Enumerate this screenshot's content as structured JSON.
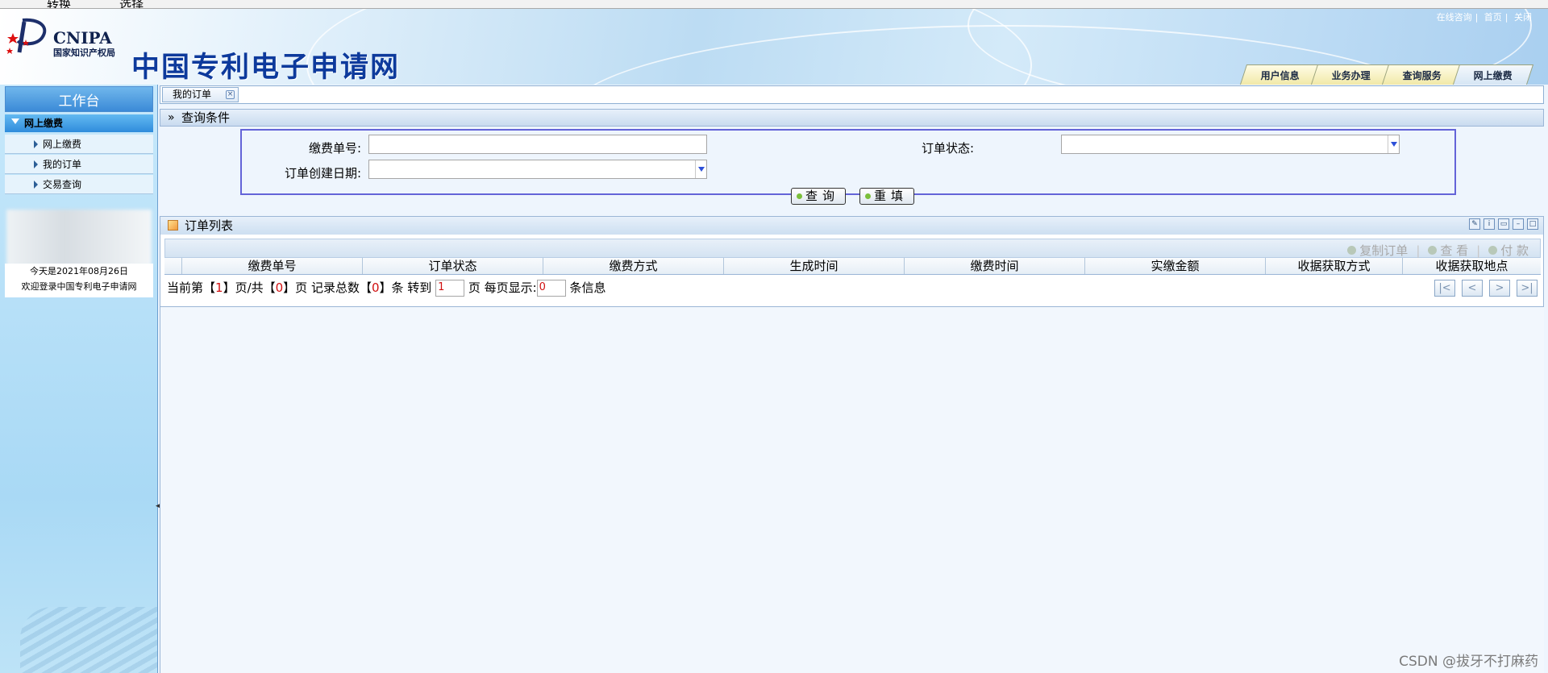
{
  "browser_toolbar": {
    "item1": "转换",
    "item2": "选择"
  },
  "header": {
    "logo_text": "CNIPA",
    "logo_subtitle": "国家知识产权局",
    "site_title": "中国专利电子申请网",
    "top_links": [
      "在线咨询",
      "首页",
      "关闭"
    ],
    "tabs": [
      "用户信息",
      "业务办理",
      "查询服务",
      "网上缴费"
    ],
    "active_tab": "网上缴费"
  },
  "sidebar": {
    "header": "工作台",
    "section": "网上缴费",
    "items": [
      "网上缴费",
      "我的订单",
      "交易查询"
    ],
    "date_text": "今天是2021年08月26日",
    "welcome_text": "欢迎登录中国专利电子申请网"
  },
  "doc_tab": {
    "label": "我的订单",
    "close_icon": "×"
  },
  "query": {
    "title": "查询条件",
    "fee_no_label": "缴费单号:",
    "order_status_label": "订单状态:",
    "create_date_label": "订单创建日期:",
    "search_button": "查询",
    "reset_button": "重填"
  },
  "order_list": {
    "title": "订单列表",
    "toolbar": [
      "复制订单",
      "查 看",
      "付 款"
    ],
    "columns": [
      "缴费单号",
      "订单状态",
      "缴费方式",
      "生成时间",
      "缴费时间",
      "实缴金额",
      "收据获取方式",
      "收据获取地点"
    ],
    "pager": {
      "p1": "当前第【",
      "current_page": "1",
      "p2": "】页/共【",
      "total_pages": "0",
      "p3": "】页 记录总数【",
      "total_records": "0",
      "p4": "】条 转到",
      "goto_value": "1",
      "p5": "页 每页显示:",
      "per_page_value": "0",
      "p6": "条信息"
    }
  },
  "watermark": "CSDN @拔牙不打麻药"
}
